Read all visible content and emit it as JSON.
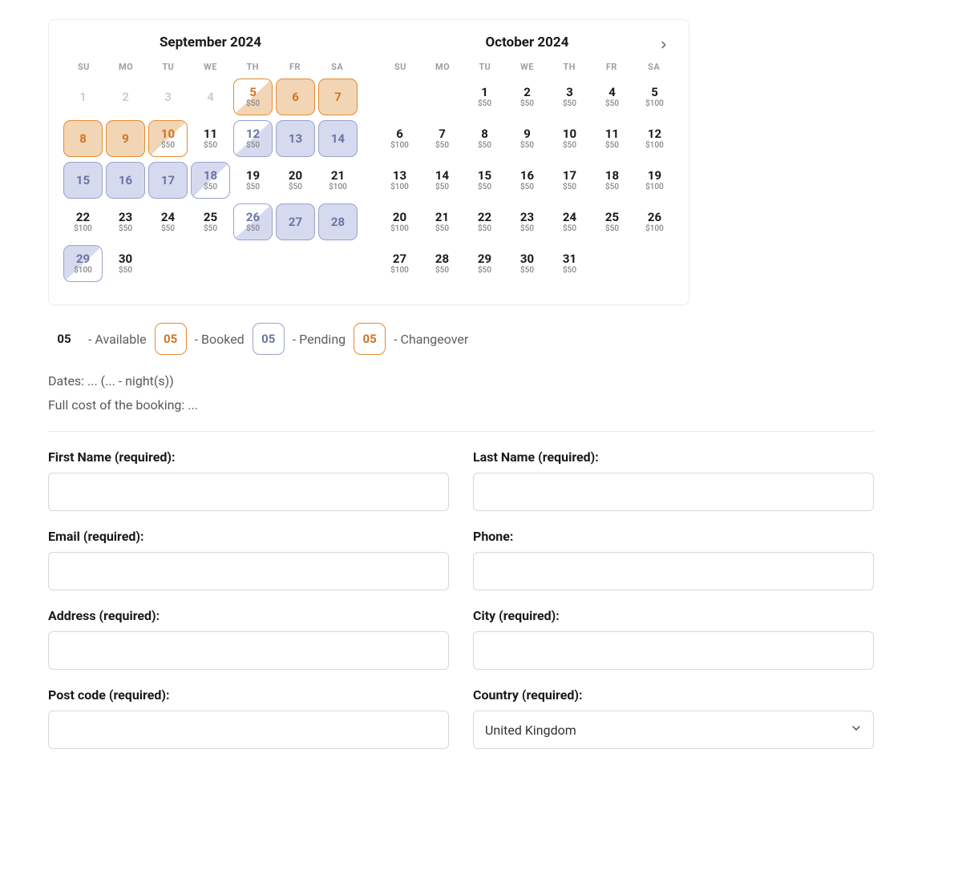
{
  "months": [
    {
      "title": "September 2024"
    },
    {
      "title": "October 2024"
    }
  ],
  "weekdays": [
    "SU",
    "MO",
    "TU",
    "WE",
    "TH",
    "FR",
    "SA"
  ],
  "sep_rows": [
    [
      {
        "num": "1",
        "status": "past"
      },
      {
        "num": "2",
        "status": "past"
      },
      {
        "num": "3",
        "status": "past"
      },
      {
        "num": "4",
        "status": "past"
      },
      {
        "num": "5",
        "status": "changeover",
        "price": "$50",
        "palette": "orange"
      },
      {
        "num": "6",
        "status": "booked"
      },
      {
        "num": "7",
        "status": "booked"
      }
    ],
    [
      {
        "num": "8",
        "status": "booked"
      },
      {
        "num": "9",
        "status": "booked"
      },
      {
        "num": "10",
        "status": "changeover",
        "price": "$50",
        "palette": "orange",
        "reverse": true
      },
      {
        "num": "11",
        "status": "available",
        "price": "$50"
      },
      {
        "num": "12",
        "status": "changeover",
        "price": "$50",
        "palette": "blue"
      },
      {
        "num": "13",
        "status": "pending"
      },
      {
        "num": "14",
        "status": "pending"
      }
    ],
    [
      {
        "num": "15",
        "status": "pending"
      },
      {
        "num": "16",
        "status": "pending"
      },
      {
        "num": "17",
        "status": "pending"
      },
      {
        "num": "18",
        "status": "changeover",
        "price": "$50",
        "palette": "blue",
        "reverse": true
      },
      {
        "num": "19",
        "status": "available",
        "price": "$50"
      },
      {
        "num": "20",
        "status": "available",
        "price": "$50"
      },
      {
        "num": "21",
        "status": "available",
        "price": "$100"
      }
    ],
    [
      {
        "num": "22",
        "status": "available",
        "price": "$100"
      },
      {
        "num": "23",
        "status": "available",
        "price": "$50"
      },
      {
        "num": "24",
        "status": "available",
        "price": "$50"
      },
      {
        "num": "25",
        "status": "available",
        "price": "$50"
      },
      {
        "num": "26",
        "status": "changeover",
        "price": "$50",
        "palette": "blue"
      },
      {
        "num": "27",
        "status": "pending"
      },
      {
        "num": "28",
        "status": "pending"
      }
    ],
    [
      {
        "num": "29",
        "status": "changeover",
        "price": "$100",
        "palette": "blue",
        "reverse": true
      },
      {
        "num": "30",
        "status": "available",
        "price": "$50"
      },
      {},
      {},
      {},
      {},
      {}
    ]
  ],
  "oct_rows": [
    [
      {},
      {},
      {
        "num": "1",
        "status": "available",
        "price": "$50"
      },
      {
        "num": "2",
        "status": "available",
        "price": "$50"
      },
      {
        "num": "3",
        "status": "available",
        "price": "$50"
      },
      {
        "num": "4",
        "status": "available",
        "price": "$50"
      },
      {
        "num": "5",
        "status": "available",
        "price": "$100"
      }
    ],
    [
      {
        "num": "6",
        "status": "available",
        "price": "$100"
      },
      {
        "num": "7",
        "status": "available",
        "price": "$50"
      },
      {
        "num": "8",
        "status": "available",
        "price": "$50"
      },
      {
        "num": "9",
        "status": "available",
        "price": "$50"
      },
      {
        "num": "10",
        "status": "available",
        "price": "$50"
      },
      {
        "num": "11",
        "status": "available",
        "price": "$50"
      },
      {
        "num": "12",
        "status": "available",
        "price": "$100"
      }
    ],
    [
      {
        "num": "13",
        "status": "available",
        "price": "$100"
      },
      {
        "num": "14",
        "status": "available",
        "price": "$50"
      },
      {
        "num": "15",
        "status": "available",
        "price": "$50"
      },
      {
        "num": "16",
        "status": "available",
        "price": "$50"
      },
      {
        "num": "17",
        "status": "available",
        "price": "$50"
      },
      {
        "num": "18",
        "status": "available",
        "price": "$50"
      },
      {
        "num": "19",
        "status": "available",
        "price": "$100"
      }
    ],
    [
      {
        "num": "20",
        "status": "available",
        "price": "$100"
      },
      {
        "num": "21",
        "status": "available",
        "price": "$50"
      },
      {
        "num": "22",
        "status": "available",
        "price": "$50"
      },
      {
        "num": "23",
        "status": "available",
        "price": "$50"
      },
      {
        "num": "24",
        "status": "available",
        "price": "$50"
      },
      {
        "num": "25",
        "status": "available",
        "price": "$50"
      },
      {
        "num": "26",
        "status": "available",
        "price": "$100"
      }
    ],
    [
      {
        "num": "27",
        "status": "available",
        "price": "$100"
      },
      {
        "num": "28",
        "status": "available",
        "price": "$50"
      },
      {
        "num": "29",
        "status": "available",
        "price": "$50"
      },
      {
        "num": "30",
        "status": "available",
        "price": "$50"
      },
      {
        "num": "31",
        "status": "available",
        "price": "$50"
      },
      {},
      {}
    ]
  ],
  "legend": {
    "chip_label": "05",
    "available": "- Available",
    "booked": "- Booked",
    "pending": "- Pending",
    "changeover": "- Changeover"
  },
  "summary": {
    "dates": "Dates: ... (... - night(s))",
    "cost": "Full cost of the booking: ..."
  },
  "form": {
    "first_name": "First Name (required):",
    "last_name": "Last Name (required):",
    "email": "Email (required):",
    "phone": "Phone:",
    "address": "Address (required):",
    "city": "City (required):",
    "post_code": "Post code (required):",
    "country": "Country (required):",
    "country_value": "United Kingdom"
  }
}
